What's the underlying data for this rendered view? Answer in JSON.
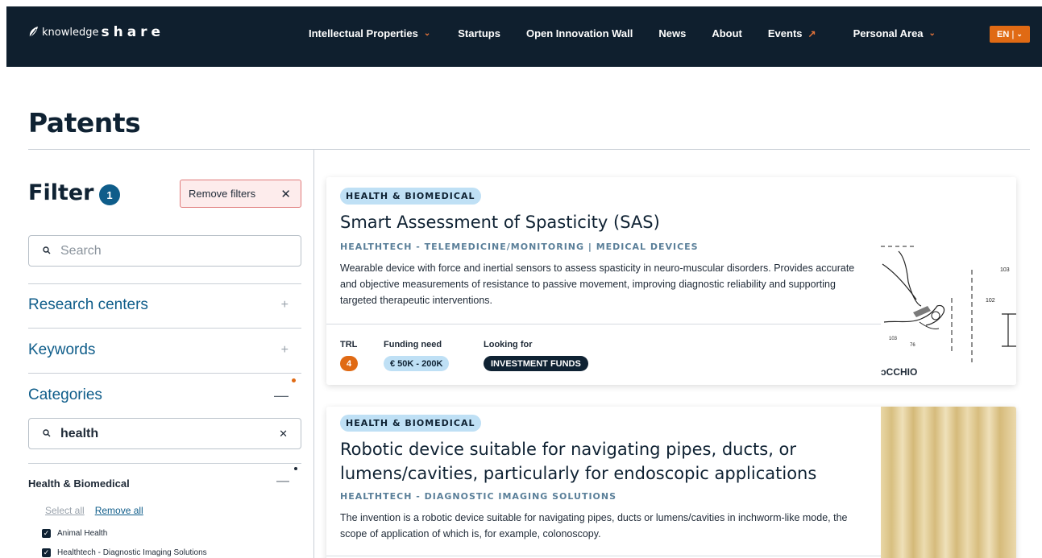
{
  "nav": {
    "logo_small": "knowledge",
    "logo_big": "share",
    "items": [
      {
        "label": "Intellectual Properties",
        "chevron": true
      },
      {
        "label": "Startups"
      },
      {
        "label": "Open Innovation Wall"
      },
      {
        "label": "News"
      },
      {
        "label": "About"
      },
      {
        "label": "Events",
        "external": true
      },
      {
        "label": "Personal Area",
        "chevron": true
      }
    ],
    "language": "EN",
    "colors": {
      "background": "#0f1f2e",
      "accent": "#e06a14"
    }
  },
  "page": {
    "title": "Patents"
  },
  "filter": {
    "title": "Filter",
    "active_count": "1",
    "remove_filters_label": "Remove filters",
    "search_placeholder": "Search",
    "sections": [
      {
        "label": "Research centers",
        "state": "collapsed"
      },
      {
        "label": "Keywords",
        "state": "collapsed"
      },
      {
        "label": "Categories",
        "state": "expanded"
      }
    ],
    "categories": {
      "search_value": "health",
      "group_title": "Health & Biomedical",
      "select_all": "Select all",
      "remove_all": "Remove all",
      "options": [
        {
          "label": "Animal Health",
          "checked": true
        },
        {
          "label": "Healthtech - Diagnostic Imaging Solutions",
          "checked": true
        }
      ]
    }
  },
  "cards": [
    {
      "category": "HEALTH & BIOMEDICAL",
      "title": "Smart Assessment of Spasticity (SAS)",
      "subcategory": "HEALTHTECH - TELEMEDICINE/MONITORING | MEDICAL DEVICES",
      "description": "Wearable device with force and inertial sensors to assess spasticity in neuro-muscular disorders. Provides accurate and objective measurements of resistance to passive movement, improving diagnostic reliability and supporting targeted therapeutic interventions.",
      "trl_label": "TRL",
      "trl_value": "4",
      "funding_label": "Funding need",
      "funding_value": "€ 50K - 200K",
      "looking_label": "Looking for",
      "looking_value": "INVESTMENT FUNDS",
      "image_caption": "ɔCCHIO",
      "image_numbers": [
        "103",
        "102",
        "103",
        "76"
      ]
    },
    {
      "category": "HEALTH & BIOMEDICAL",
      "title": "Robotic device suitable for navigating pipes, ducts, or lumens/cavities, particularly for endoscopic applications",
      "subcategory": "HEALTHTECH - DIAGNOSTIC IMAGING SOLUTIONS",
      "description": "The invention is a robotic device suitable for navigating pipes, ducts or lumens/cavities in inchworm-like mode, the scope of application of which is, for example, colonoscopy."
    }
  ]
}
